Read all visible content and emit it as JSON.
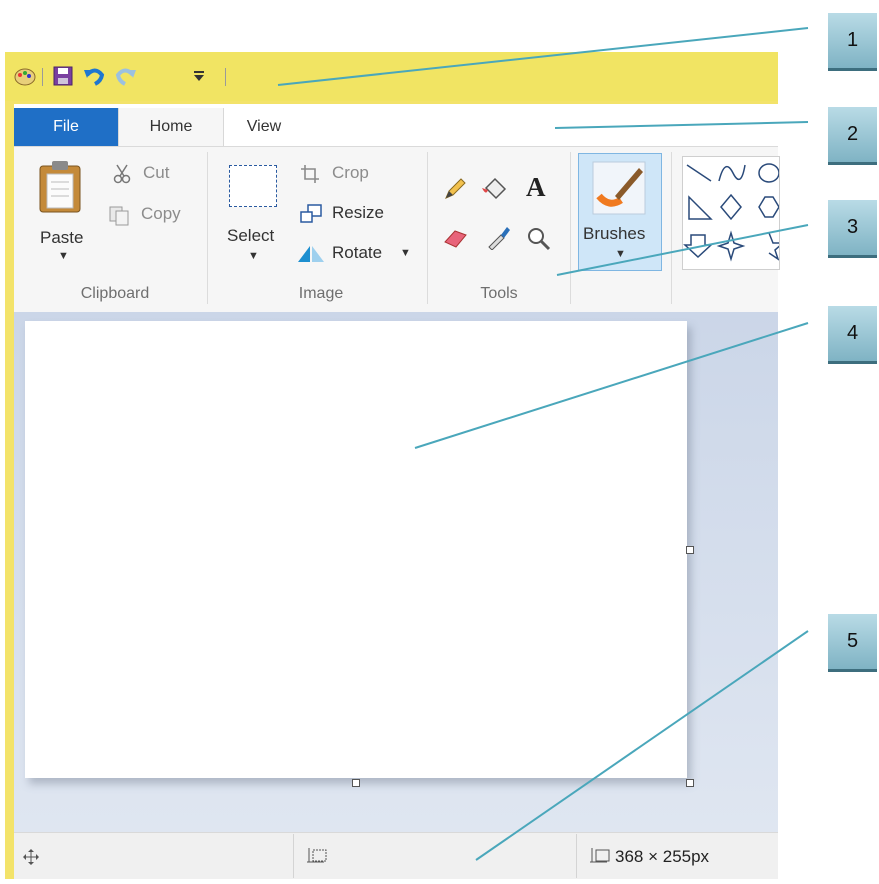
{
  "qat": {
    "icons": [
      "paint-app-icon",
      "save-icon",
      "undo-icon",
      "redo-icon",
      "customize-dropdown-icon"
    ]
  },
  "tabs": [
    {
      "label": "File"
    },
    {
      "label": "Home"
    },
    {
      "label": "View"
    }
  ],
  "clipboard": {
    "paste": "Paste",
    "cut": "Cut",
    "copy": "Copy",
    "group": "Clipboard"
  },
  "image": {
    "select": "Select",
    "crop": "Crop",
    "resize": "Resize",
    "rotate": "Rotate",
    "group": "Image"
  },
  "tools": {
    "group": "Tools",
    "text_tool_glyph": "A"
  },
  "brushes": {
    "label": "Brushes"
  },
  "status": {
    "canvas_size": "368 × 255px"
  },
  "callouts": [
    "1",
    "2",
    "3",
    "4",
    "5"
  ],
  "colors": {
    "file_tab": "#1f6fc6",
    "window_frame": "#f3e36a",
    "callout": "#8fbfcf",
    "leader_line": "#4aa7bb"
  }
}
